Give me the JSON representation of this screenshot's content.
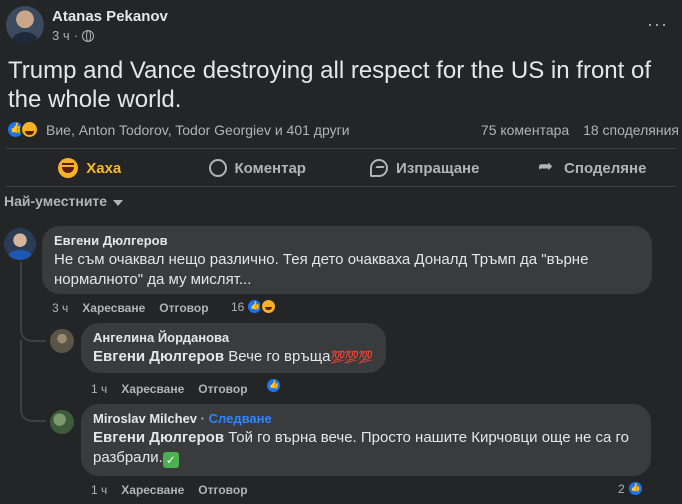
{
  "post": {
    "author": "Atanas Pekanov",
    "time": "3 ч",
    "more": "···",
    "text": "Trump and Vance destroying all respect for the US in front of the whole world.",
    "reactions_names": "Вие, Anton Todorov, Todor Georgiev и 401 други",
    "comments_count": "75 коментара",
    "shares_count": "18 споделяния"
  },
  "actions": {
    "reaction": "Хаха",
    "comment": "Коментар",
    "send": "Изпращане",
    "share": "Споделяне"
  },
  "sort": {
    "label": "Най-уместните"
  },
  "comments": [
    {
      "name": "Евгени Дюлгеров",
      "text": "Не съм очаквал нещо различно. Тея дето очакваха Доналд Тръмп да \"върне нормалното\" да му мислят...",
      "time": "3 ч",
      "like": "Харесване",
      "reply": "Отговор",
      "reactions": "16"
    }
  ],
  "replies": [
    {
      "name": "Ангелина Йорданова",
      "mention": "Евгени Дюлгеров",
      "text": " Вече го връща",
      "emoji": "💯💯💯",
      "time": "1 ч",
      "like": "Харесване",
      "reply": "Отговор"
    },
    {
      "name": "Miroslav Milchev",
      "follow_sep": "·",
      "follow": "Следване",
      "mention": "Евгени Дюлгеров",
      "text": " Той го върна вече. Просто нашите Кирчовци още не са го разбрали.",
      "emoji": "✓",
      "time": "1 ч",
      "like": "Харесване",
      "reply": "Отговор",
      "reactions": "2"
    }
  ],
  "colors": {
    "background": "#242526",
    "bubble": "#3a3b3c",
    "haha_active": "#f7b928",
    "link_blue": "#2d88ff",
    "like_blue": "#1877f2"
  }
}
